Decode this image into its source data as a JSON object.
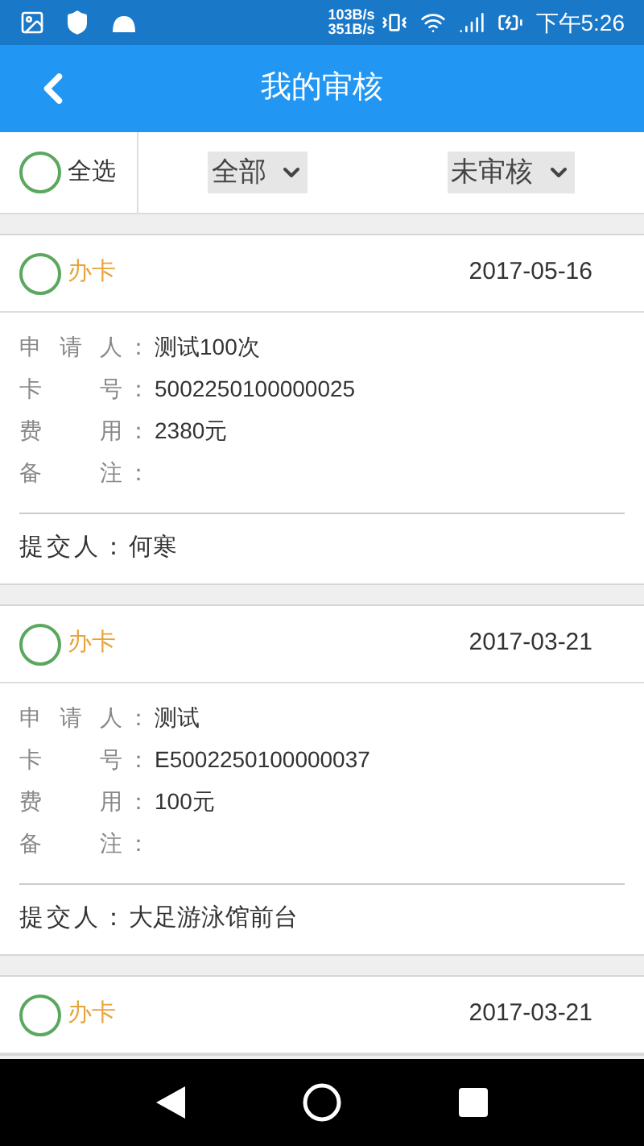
{
  "status_bar": {
    "upload_speed": "103B/s",
    "download_speed": "351B/s",
    "time": "下午5:26"
  },
  "app_bar": {
    "title": "我的审核"
  },
  "filter_bar": {
    "select_all": {
      "label": "全选",
      "selected": false
    },
    "dropdowns": [
      {
        "value": "全部"
      },
      {
        "value": "未审核"
      }
    ]
  },
  "cards": [
    {
      "selected": false,
      "type": "办卡",
      "date": "2017-05-16",
      "fields": [
        {
          "label": "申请人",
          "colon": "：",
          "value": "测试100次"
        },
        {
          "label": "卡号",
          "colon": "：",
          "value": "5002250100000025"
        },
        {
          "label": "费用",
          "colon": "：",
          "value": "2380元"
        },
        {
          "label": "备注",
          "colon": "："
        }
      ],
      "submitter_label": "提交人：",
      "submitter": "何寒"
    },
    {
      "selected": false,
      "type": "办卡",
      "date": "2017-03-21",
      "fields": [
        {
          "label": "申请人",
          "colon": "：",
          "value": "测试"
        },
        {
          "label": "卡号",
          "colon": "：",
          "value": "E5002250100000037"
        },
        {
          "label": "费用",
          "colon": "：",
          "value": "100元"
        },
        {
          "label": "备注",
          "colon": "："
        }
      ],
      "submitter_label": "提交人：",
      "submitter": "大足游泳馆前台"
    },
    {
      "selected": false,
      "type": "办卡",
      "date": "2017-03-21"
    }
  ]
}
